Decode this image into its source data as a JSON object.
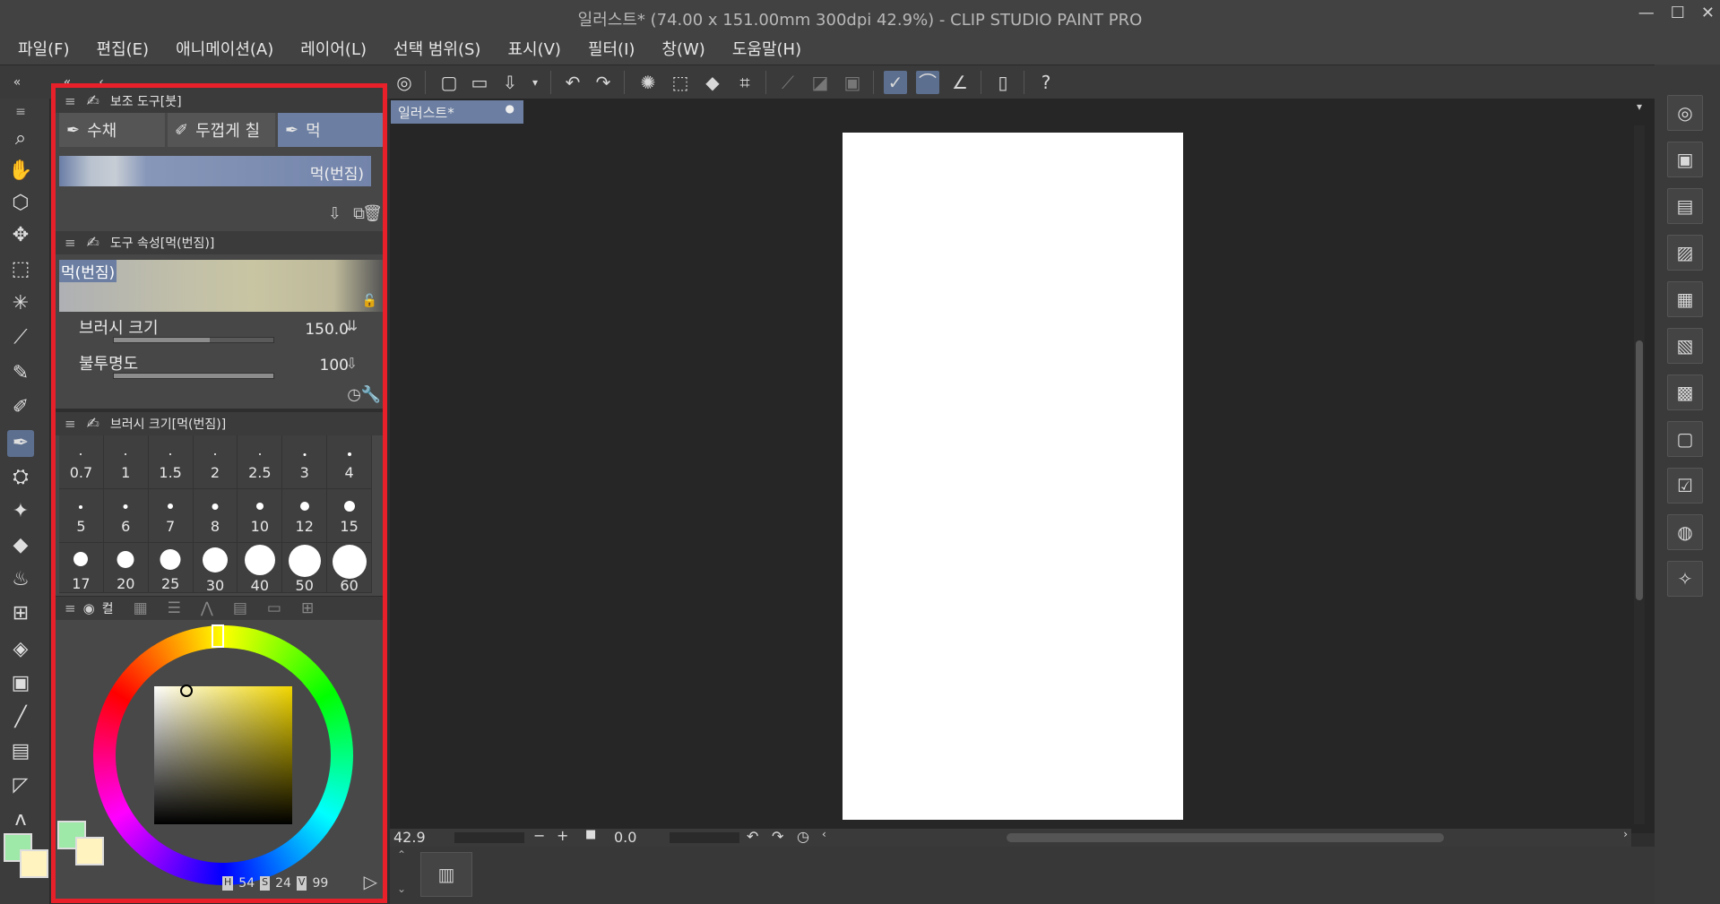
{
  "window": {
    "title": "일러스트* (74.00 x 151.00mm 300dpi 42.9%)  - CLIP STUDIO PAINT PRO",
    "minimize": "—",
    "maximize": "☐",
    "close": "✕"
  },
  "menu": [
    "파일(F)",
    "편집(E)",
    "애니메이션(A)",
    "레이어(L)",
    "선택 범위(S)",
    "표시(V)",
    "필터(I)",
    "창(W)",
    "도움말(H)"
  ],
  "sub_tool_panel": {
    "title": "보조 도구[붓]",
    "tabs": [
      "수채",
      "두껍게 칠",
      "먹"
    ],
    "selected_brush": "먹(번짐)"
  },
  "tool_property": {
    "title": "도구 속성[먹(번짐)]",
    "preview_label": "먹(번짐)",
    "brush_size_label": "브러시 크기",
    "brush_size_value": "150.0",
    "opacity_label": "불투명도",
    "opacity_value": "100"
  },
  "brush_size_panel": {
    "title": "브러시 크기[먹(번짐)]",
    "sizes_row1": [
      "0.7",
      "1",
      "1.5",
      "2",
      "2.5",
      "3",
      "4"
    ],
    "sizes_row2": [
      "5",
      "6",
      "7",
      "8",
      "10",
      "12",
      "15"
    ],
    "sizes_row3": [
      "17",
      "20",
      "25",
      "30",
      "40",
      "50",
      "60"
    ]
  },
  "color_panel": {
    "tab_label": "컬",
    "h_label": "H",
    "h_value": "54",
    "s_label": "S",
    "s_value": "24",
    "v_label": "V",
    "v_value": "99",
    "main_color": "#9ee8a8",
    "sub_color": "#fff3c0"
  },
  "document": {
    "tab": "일러스트*",
    "zoom": "42.9",
    "rotation": "0.0"
  }
}
